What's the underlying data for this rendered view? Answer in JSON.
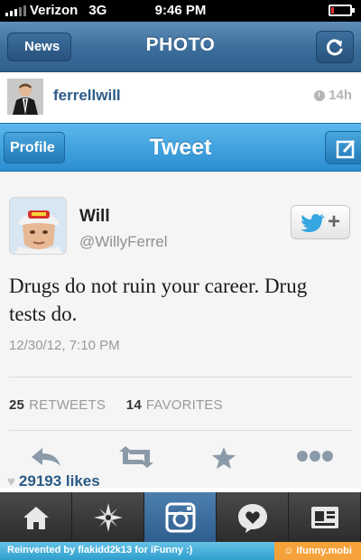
{
  "status_bar": {
    "carrier": "Verizon",
    "network": "3G",
    "time": "9:46 PM"
  },
  "nav": {
    "back_label": "News",
    "title": "PHOTO",
    "refresh_icon": "refresh-icon"
  },
  "post": {
    "username": "ferrellwill",
    "time_ago": "14h",
    "likes": "29193 likes"
  },
  "tweet_screen": {
    "profile_label": "Profile",
    "title": "Tweet",
    "name": "Will",
    "handle": "@WillyFerrel",
    "follow_plus": "+",
    "text": "Drugs do not ruin your career. Drug tests do.",
    "date": "12/30/12, 7:10 PM",
    "retweets_count": "25",
    "retweets_label": "RETWEETS",
    "favorites_count": "14",
    "favorites_label": "FAVORITES",
    "actions": [
      "reply-icon",
      "retweet-icon",
      "star-icon",
      "more-icon"
    ]
  },
  "tab_bar": {
    "tabs": [
      "home-icon",
      "explore-icon",
      "camera-icon",
      "news-icon",
      "profile-icon"
    ],
    "active": "camera-icon"
  },
  "footer": {
    "credit": "Reinvented by flakidd2k13 for iFunny :)",
    "brand": "ifunny.mobi"
  },
  "colors": {
    "instagram_blue": "#3e6f9c",
    "twitter_blue": "#2b8ed0",
    "link_blue": "#2b5b86"
  }
}
